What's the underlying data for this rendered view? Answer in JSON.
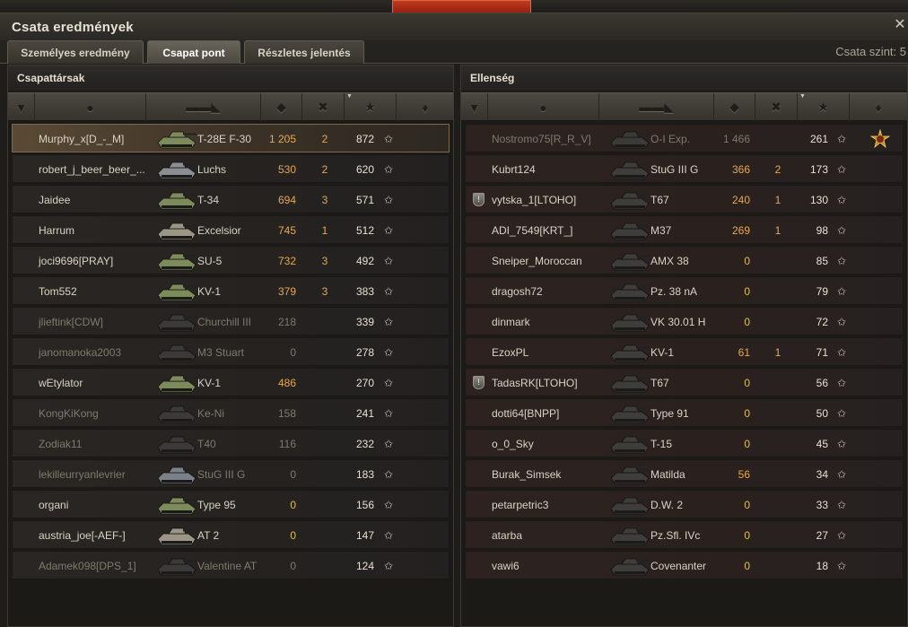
{
  "window": {
    "title": "Csata eredmények",
    "close_icon": "close-icon",
    "battle_level_label": "Csata szint: 5"
  },
  "tabs": [
    {
      "label": "Személyes eredmény",
      "active": false
    },
    {
      "label": "Csapat pont",
      "active": true
    },
    {
      "label": "Részletes jelentés",
      "active": false
    }
  ],
  "allies": {
    "title": "Csapattársak",
    "rows": [
      {
        "name": "Murphy_x[D_-_M]",
        "tank": "T-28E F-30",
        "damage": "1 205",
        "kills": "2",
        "xp": "872",
        "self": true,
        "dead": false,
        "tank_color": "#7d8a5a"
      },
      {
        "name": "robert_j_beer_beer_...",
        "tank": "Luchs",
        "damage": "530",
        "kills": "2",
        "xp": "620",
        "self": false,
        "dead": false,
        "tank_color": "#8a8d92"
      },
      {
        "name": "Jaidee",
        "tank": "T-34",
        "damage": "694",
        "kills": "3",
        "xp": "571",
        "self": false,
        "dead": false,
        "tank_color": "#7d8a5a"
      },
      {
        "name": "Harrum",
        "tank": "Excelsior",
        "damage": "745",
        "kills": "1",
        "xp": "512",
        "self": false,
        "dead": false,
        "tank_color": "#9a9584"
      },
      {
        "name": "joci9696[PRAY]",
        "tank": "SU-5",
        "damage": "732",
        "kills": "3",
        "xp": "492",
        "self": false,
        "dead": false,
        "tank_color": "#7d8a5a"
      },
      {
        "name": "Tom552",
        "tank": "KV-1",
        "damage": "379",
        "kills": "3",
        "xp": "383",
        "self": false,
        "dead": false,
        "tank_color": "#7d8a5a"
      },
      {
        "name": "jlieftink[CDW]",
        "tank": "Churchill III",
        "damage": "218",
        "kills": "",
        "xp": "339",
        "self": false,
        "dead": true,
        "tank_color": "#3c3a36"
      },
      {
        "name": "janomanoka2003",
        "tank": "M3 Stuart",
        "damage": "0",
        "kills": "",
        "xp": "278",
        "self": false,
        "dead": true,
        "tank_color": "#3c3a36"
      },
      {
        "name": "wEtylator",
        "tank": "KV-1",
        "damage": "486",
        "kills": "",
        "xp": "270",
        "self": false,
        "dead": false,
        "tank_color": "#7d8a5a"
      },
      {
        "name": "KongKiKong",
        "tank": "Ke-Ni",
        "damage": "158",
        "kills": "",
        "xp": "241",
        "self": false,
        "dead": true,
        "tank_color": "#3c3a36"
      },
      {
        "name": "Zodiak11",
        "tank": "T40",
        "damage": "116",
        "kills": "",
        "xp": "232",
        "self": false,
        "dead": true,
        "tank_color": "#3c3a36"
      },
      {
        "name": "lekilleurryanlevrier",
        "tank": "StuG III G",
        "damage": "0",
        "kills": "",
        "xp": "183",
        "self": false,
        "dead": true,
        "tank_color": "#7c8088"
      },
      {
        "name": "organi",
        "tank": "Type 95",
        "damage": "0",
        "kills": "",
        "xp": "156",
        "self": false,
        "dead": false,
        "tank_color": "#7d8a5a"
      },
      {
        "name": "austria_joe[-AEF-]",
        "tank": "AT 2",
        "damage": "0",
        "kills": "",
        "xp": "147",
        "self": false,
        "dead": false,
        "tank_color": "#9a9584"
      },
      {
        "name": "Adamek098[DPS_1]",
        "tank": "Valentine AT",
        "damage": "0",
        "kills": "",
        "xp": "124",
        "self": false,
        "dead": true,
        "tank_color": "#3c3a36"
      }
    ]
  },
  "enemies": {
    "title": "Ellenség",
    "rows": [
      {
        "name": "Nostromo75[R_R_V]",
        "tank": "O-I Exp.",
        "damage": "1 466",
        "kills": "",
        "xp": "261",
        "dead": true,
        "clan": false,
        "medal": true
      },
      {
        "name": "Kubrt124",
        "tank": "StuG III G",
        "damage": "366",
        "kills": "2",
        "xp": "173",
        "dead": false,
        "clan": false,
        "medal": false
      },
      {
        "name": "vytska_1[LTOHO]",
        "tank": "T67",
        "damage": "240",
        "kills": "1",
        "xp": "130",
        "dead": false,
        "clan": true,
        "medal": false
      },
      {
        "name": "ADI_7549[KRT_]",
        "tank": "M37",
        "damage": "269",
        "kills": "1",
        "xp": "98",
        "dead": false,
        "clan": false,
        "medal": false
      },
      {
        "name": "Sneiper_Moroccan",
        "tank": "AMX 38",
        "damage": "0",
        "kills": "",
        "xp": "85",
        "dead": false,
        "clan": false,
        "medal": false
      },
      {
        "name": "dragosh72",
        "tank": "Pz. 38 nA",
        "damage": "0",
        "kills": "",
        "xp": "79",
        "dead": false,
        "clan": false,
        "medal": false
      },
      {
        "name": "dinmark",
        "tank": "VK 30.01 H",
        "damage": "0",
        "kills": "",
        "xp": "72",
        "dead": false,
        "clan": false,
        "medal": false
      },
      {
        "name": "EzoxPL",
        "tank": "KV-1",
        "damage": "61",
        "kills": "1",
        "xp": "71",
        "dead": false,
        "clan": false,
        "medal": false
      },
      {
        "name": "TadasRK[LTOHO]",
        "tank": "T67",
        "damage": "0",
        "kills": "",
        "xp": "56",
        "dead": false,
        "clan": true,
        "medal": false
      },
      {
        "name": "dotti64[BNPP]",
        "tank": "Type 91",
        "damage": "0",
        "kills": "",
        "xp": "50",
        "dead": false,
        "clan": false,
        "medal": false
      },
      {
        "name": "o_0_Sky",
        "tank": "T-15",
        "damage": "0",
        "kills": "",
        "xp": "45",
        "dead": false,
        "clan": false,
        "medal": false
      },
      {
        "name": "Burak_Simsek",
        "tank": "Matilda",
        "damage": "56",
        "kills": "",
        "xp": "34",
        "dead": false,
        "clan": false,
        "medal": false
      },
      {
        "name": "petarpetric3",
        "tank": "D.W. 2",
        "damage": "0",
        "kills": "",
        "xp": "33",
        "dead": false,
        "clan": false,
        "medal": false
      },
      {
        "name": "atarba",
        "tank": "Pz.Sfl. IVc",
        "damage": "0",
        "kills": "",
        "xp": "27",
        "dead": false,
        "clan": false,
        "medal": false
      },
      {
        "name": "vawi6",
        "tank": "Covenanter",
        "damage": "0",
        "kills": "",
        "xp": "18",
        "dead": false,
        "clan": false,
        "medal": false
      }
    ]
  },
  "column_icons": [
    "squad-icon",
    "player-icon",
    "tank-icon",
    "damage-icon",
    "kills-icon",
    "xp-star-icon",
    "medal-icon"
  ],
  "colors": {
    "damage": "#e5a94f",
    "self_row": "#5a4a35",
    "accent_red": "#c23a1e"
  }
}
